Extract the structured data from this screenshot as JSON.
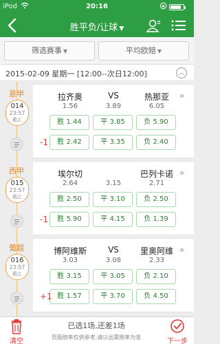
{
  "status_bar": {
    "carrier": "iPod",
    "time": "20:16",
    "battery_level": 0.85
  },
  "header": {
    "title": "胜平负/让球",
    "back_icon": "back-arrow-icon",
    "user_icon": "user-icon",
    "menu_icon": "list-menu-icon"
  },
  "filters": {
    "event_filter": "筛选赛事",
    "avg_odds": "平均欧赔"
  },
  "date_bar": {
    "text": "2015-02-09 星期一 [12:00--次日12:00]"
  },
  "matches": [
    {
      "league": "意甲",
      "number": "014",
      "time": "23:57",
      "state": "截止",
      "home": "拉齐奥",
      "vs": "VS",
      "away": "热那亚",
      "odds": [
        "1.56",
        "3.89",
        "6.05"
      ],
      "win": "胜 1.44",
      "draw": "平 3.85",
      "lose": "负 5.90",
      "handicap": "-1",
      "h_win": "胜 2.42",
      "h_draw": "平 3.35",
      "h_lose": "负 2.40"
    },
    {
      "league": "西甲",
      "number": "015",
      "time": "23:57",
      "state": "截止",
      "home": "埃尔切",
      "vs": "",
      "away": "巴列卡诺",
      "odds": [
        "2.64",
        "3.15",
        "2.71"
      ],
      "win": "胜 2.50",
      "draw": "平 3.10",
      "lose": "负 2.50",
      "handicap": "-1",
      "h_win": "胜 5.90",
      "h_draw": "平 4.15",
      "h_lose": "负 1.39"
    },
    {
      "league": "葡超",
      "number": "016",
      "time": "23:57",
      "state": "截止",
      "home": "博阿维斯",
      "vs": "VS",
      "away": "里奥阿维",
      "odds": [
        "3.03",
        "3.08",
        "2.33"
      ],
      "win": "胜 3.15",
      "draw": "平 3.05",
      "lose": "负 2.10",
      "handicap": "+1",
      "h_win": "胜 1.57",
      "h_draw": "平 3.70",
      "h_lose": "负 4.50"
    }
  ],
  "bottom": {
    "clear_label": "清空",
    "selection": "已选1场,还差1场",
    "note": "页面赔率仅供参考,请以出票赔率为准",
    "next_label": "下一步"
  },
  "colors": {
    "brand_green": "#2e9e44",
    "accent_red": "#e53935",
    "league_orange": "#e6852a"
  }
}
